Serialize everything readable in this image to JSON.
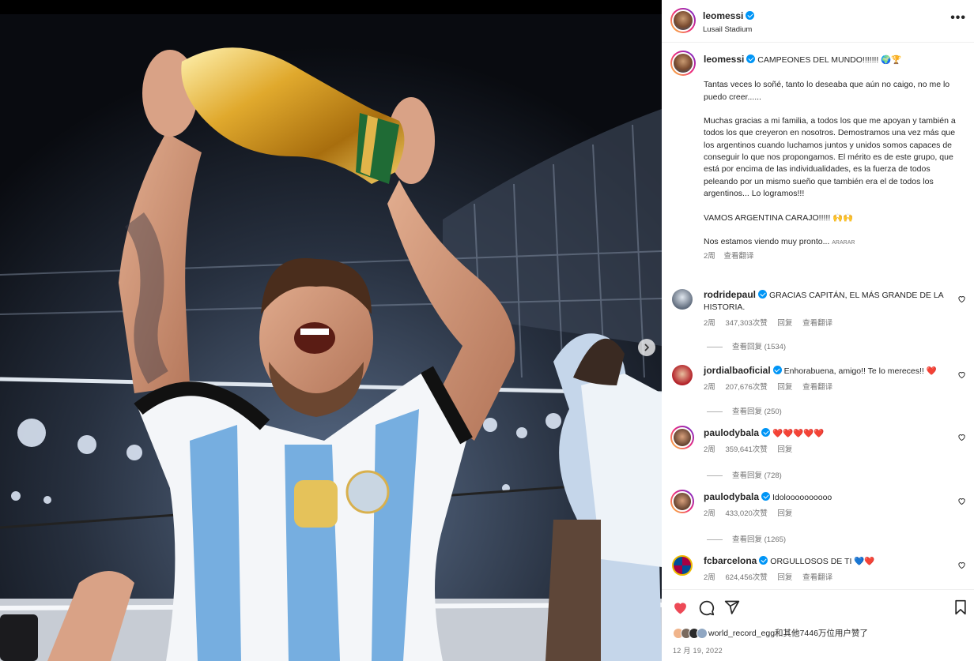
{
  "post": {
    "username": "leomessi",
    "location": "Lusail Stadium"
  },
  "caption": {
    "username": "leomessi",
    "headline": "CAMPEONES DEL MUNDO!!!!!!!",
    "headline_emoji": "🌍🏆",
    "p1": "Tantas veces lo soñé, tanto lo deseaba que aún no caigo, no me lo puedo creer......",
    "p2": "Muchas gracias a mi familia, a todos los que me apoyan y también a todos los que creyeron en nosotros. Demostramos una vez más que los argentinos cuando luchamos juntos y unidos somos capaces de conseguir lo que nos propongamos. El mérito es de este grupo, que está por encima de las individualidades, es la fuerza de todos peleando por un mismo sueño que también era el de todos los argentinos... Lo logramos!!!",
    "p3": "VAMOS ARGENTINA CARAJO!!!!! 🙌🙌",
    "p4": "Nos estamos viendo muy pronto...",
    "p4_flags": "ARARAR",
    "age": "2周",
    "translate": "查看翻译"
  },
  "comments": [
    {
      "user": "rodridepaul",
      "text": "GRACIAS CAPITÁN, EL MÁS GRANDE DE LA HISTORIA.",
      "age": "2周",
      "likes": "347,303次赞",
      "reply": "回复",
      "translate": "查看翻译",
      "replies": "查看回复 (1534)"
    },
    {
      "user": "jordialbaoficial",
      "text": "Enhorabuena, amigo!! Te lo mereces!! ❤️",
      "age": "2周",
      "likes": "207,676次赞",
      "reply": "回复",
      "translate": "查看翻译",
      "replies": "查看回复 (250)"
    },
    {
      "user": "paulodybala",
      "text": "❤️❤️❤️❤️❤️",
      "age": "2周",
      "likes": "359,641次赞",
      "reply": "回复",
      "translate": "",
      "replies": "查看回复 (728)"
    },
    {
      "user": "paulodybala",
      "text": "Idoloooooooooo",
      "age": "2周",
      "likes": "433,020次赞",
      "reply": "回复",
      "translate": "",
      "replies": "查看回复 (1265)"
    },
    {
      "user": "fcbarcelona",
      "text": "ORGULLOSOS DE TI 💙❤️",
      "age": "2周",
      "likes": "624,456次赞",
      "reply": "回复",
      "translate": "查看翻译",
      "replies": ""
    }
  ],
  "footer": {
    "likes_text": "world_record_egg和其他7446万位用户赞了",
    "date": "12 月 19, 2022"
  },
  "colors": {
    "verified": "#0095f6",
    "like_red": "#ed4956",
    "text": "#262626",
    "secondary": "#737373"
  }
}
